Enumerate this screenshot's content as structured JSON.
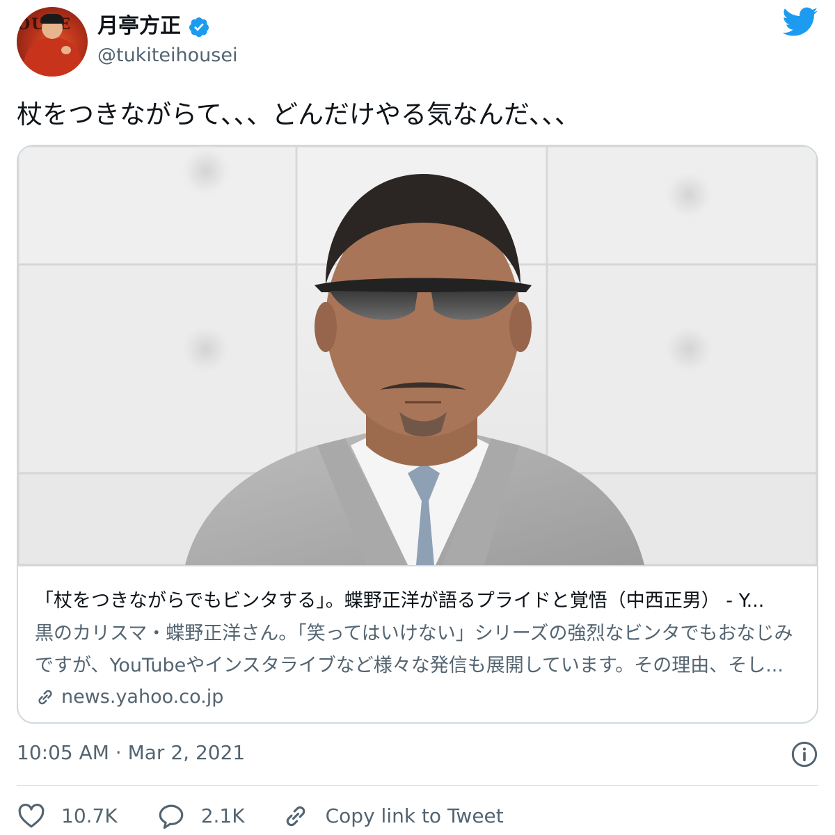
{
  "author": {
    "display_name": "月亭方正",
    "username": "@tukiteihousei",
    "avatar_sign_text": "OUSE",
    "verified": true
  },
  "tweet_text": "杖をつきながらて、、、どんだけやる気なんだ、、、",
  "card": {
    "title": "「杖をつきながらでもビンタする」。蝶野正洋が語るプライドと覚悟（中西正男） - Y...",
    "description_lines": [
      "黒のカリスマ・蝶野正洋さん。「笑ってはいけない」シリーズの強烈なビンタでもおなじみ",
      "ですが、YouTubeやインスタライブなど様々な発信も展開しています。その理由、そし..."
    ],
    "domain": "news.yahoo.co.jp"
  },
  "timestamp": "10:05 AM · Mar 2, 2021",
  "actions": {
    "like_count": "10.7K",
    "reply_count": "2.1K",
    "copy_link_label": "Copy link to Tweet"
  },
  "colors": {
    "brand": "#1d9bf0",
    "text_primary": "#0f1419",
    "text_secondary": "#536471",
    "border": "#cfd9de"
  },
  "icons": {
    "verified": "verified-badge-icon",
    "twitter": "twitter-bird-icon",
    "link": "link-icon",
    "info": "info-icon",
    "like": "heart-icon",
    "reply": "reply-bubble-icon",
    "copy_link": "chain-link-icon"
  }
}
